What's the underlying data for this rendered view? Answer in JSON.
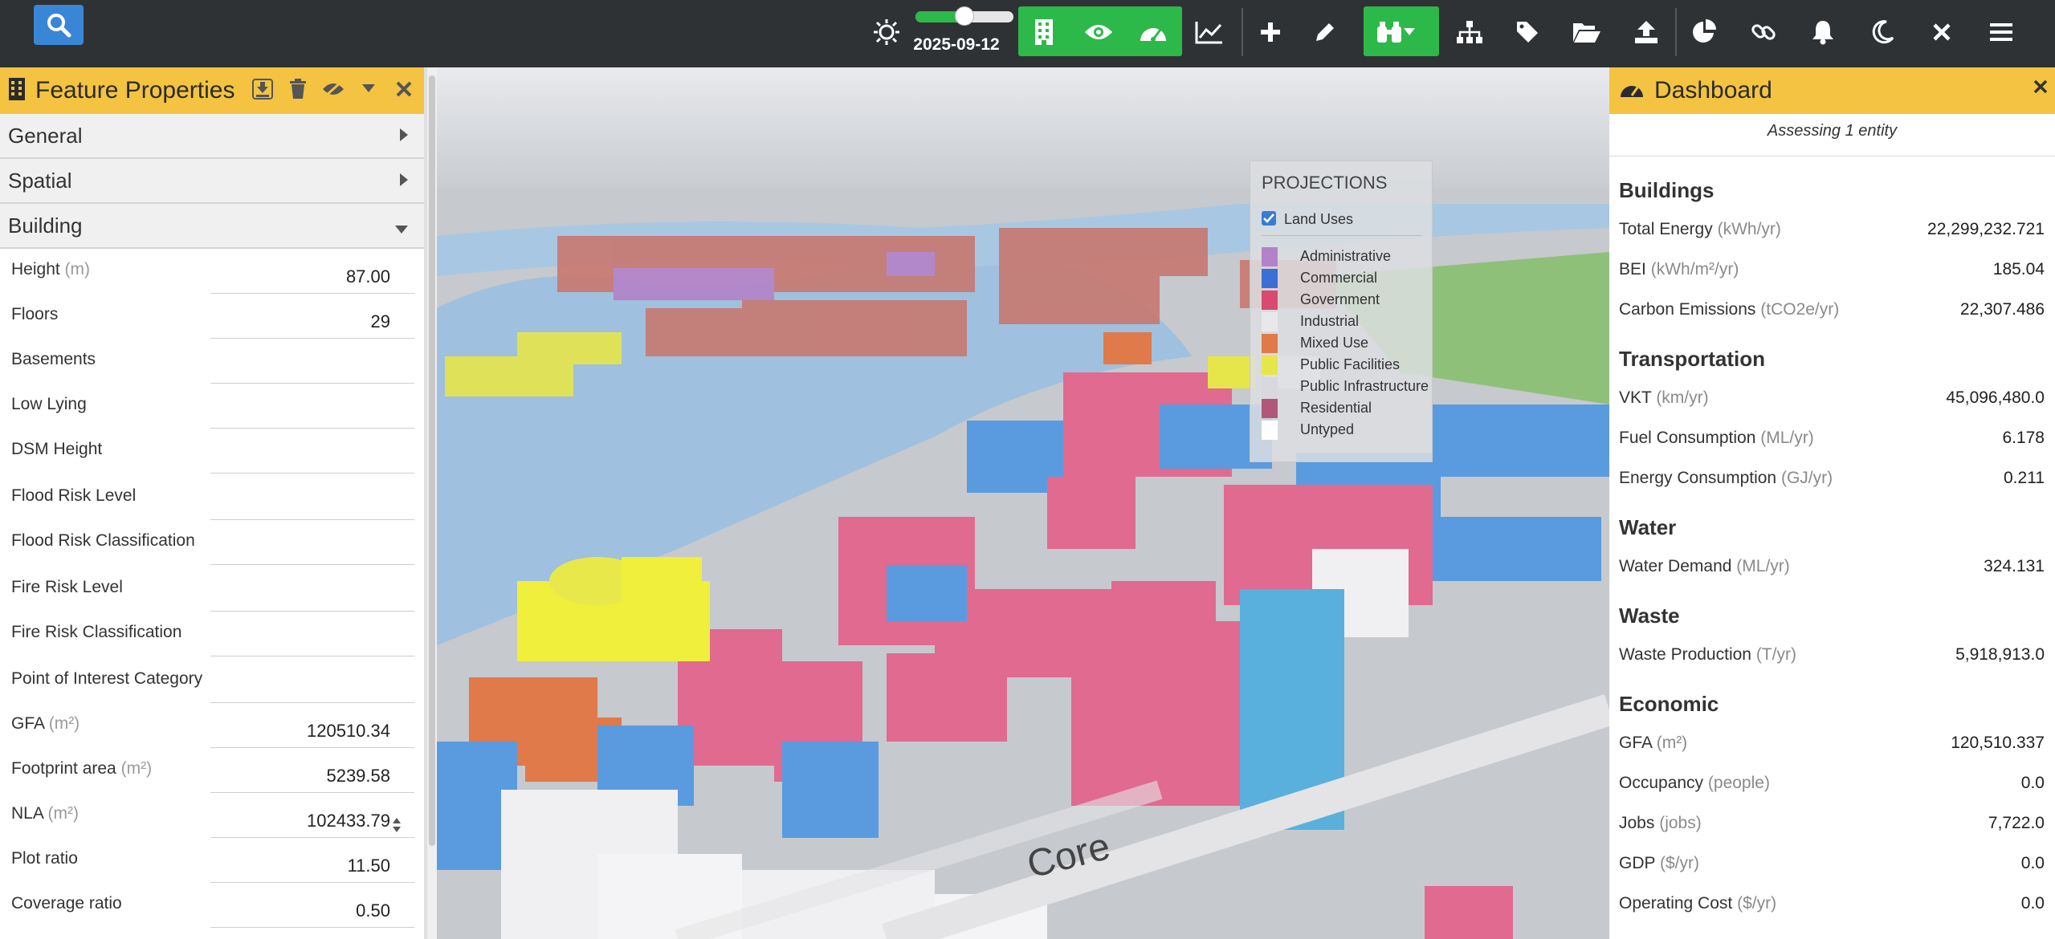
{
  "topbar": {
    "date": "2025-09-12",
    "time_slider_value_fraction": 0.5,
    "icons": [
      "search-icon",
      "sun-icon",
      "building-icon",
      "eye-icon",
      "dashboard-gauge-icon",
      "line-chart-icon",
      "plus-icon",
      "pencil-icon",
      "binoculars-icon",
      "caret-down-icon",
      "hierarchy-icon",
      "tag-icon",
      "folder-open-icon",
      "upload-icon",
      "pie-chart-icon",
      "link-icon",
      "bell-icon",
      "moon-icon",
      "close-icon",
      "menu-icon"
    ],
    "accent_green": "#2db84a",
    "search_blue": "#3a86d6"
  },
  "left": {
    "title": "Feature Properties",
    "sections": [
      "General",
      "Spatial",
      "Building"
    ],
    "props": [
      {
        "name": "Height",
        "unit": "(m)",
        "value": "87.00"
      },
      {
        "name": "Floors",
        "unit": "",
        "value": "29"
      },
      {
        "name": "Basements",
        "unit": "",
        "value": ""
      },
      {
        "name": "Low Lying",
        "unit": "",
        "value": ""
      },
      {
        "name": "DSM Height",
        "unit": "",
        "value": ""
      },
      {
        "name": "Flood Risk Level",
        "unit": "",
        "value": ""
      },
      {
        "name": "Flood Risk Classification",
        "unit": "",
        "value": ""
      },
      {
        "name": "Fire Risk Level",
        "unit": "",
        "value": ""
      },
      {
        "name": "Fire Risk Classification",
        "unit": "",
        "value": ""
      },
      {
        "name": "Point of Interest Category",
        "unit": "",
        "value": ""
      },
      {
        "name": "GFA",
        "unit": "(m²)",
        "value": "120510.34"
      },
      {
        "name": "Footprint area",
        "unit": "(m²)",
        "value": "5239.58"
      },
      {
        "name": "NLA",
        "unit": "(m²)",
        "value": "102433.79"
      },
      {
        "name": "Plot ratio",
        "unit": "",
        "value": "11.50"
      },
      {
        "name": "Coverage ratio",
        "unit": "",
        "value": "0.50"
      }
    ]
  },
  "legend": {
    "title": "PROJECTIONS",
    "layer_label": "Land Uses",
    "layer_checked": true,
    "items": [
      {
        "name": "Administrative",
        "color": "#b482c8"
      },
      {
        "name": "Commercial",
        "color": "#3a6fd6"
      },
      {
        "name": "Government",
        "color": "#d84a6e"
      },
      {
        "name": "Industrial",
        "color": "#e8e8ea"
      },
      {
        "name": "Mixed Use",
        "color": "#e07a4a"
      },
      {
        "name": "Public Facilities",
        "color": "#e6e64a"
      },
      {
        "name": "Public Infrastructure",
        "color": "#d8d8de"
      },
      {
        "name": "Residential",
        "color": "#b0587a"
      },
      {
        "name": "Untyped",
        "color": "#ffffff"
      }
    ]
  },
  "dashboard": {
    "title": "Dashboard",
    "assessing": "Assessing 1 entity",
    "sections": [
      {
        "title": "Buildings",
        "rows": [
          {
            "k": "Total Energy",
            "u": "(kWh/yr)",
            "v": "22,299,232.721"
          },
          {
            "k": "BEI",
            "u": "(kWh/m²/yr)",
            "v": "185.04"
          },
          {
            "k": "Carbon Emissions",
            "u": "(tCO2e/yr)",
            "v": "22,307.486"
          }
        ]
      },
      {
        "title": "Transportation",
        "rows": [
          {
            "k": "VKT",
            "u": "(km/yr)",
            "v": "45,096,480.0"
          },
          {
            "k": "Fuel Consumption",
            "u": "(ML/yr)",
            "v": "6.178"
          },
          {
            "k": "Energy Consumption",
            "u": "(GJ/yr)",
            "v": "0.211"
          }
        ]
      },
      {
        "title": "Water",
        "rows": [
          {
            "k": "Water Demand",
            "u": "(ML/yr)",
            "v": "324.131"
          }
        ]
      },
      {
        "title": "Waste",
        "rows": [
          {
            "k": "Waste Production",
            "u": "(T/yr)",
            "v": "5,918,913.0"
          }
        ]
      },
      {
        "title": "Economic",
        "rows": [
          {
            "k": "GFA",
            "u": "(m²)",
            "v": "120,510.337"
          },
          {
            "k": "Occupancy",
            "u": "(people)",
            "v": "0.0"
          },
          {
            "k": "Jobs",
            "u": "(jobs)",
            "v": "7,722.0"
          },
          {
            "k": "GDP",
            "u": "($/yr)",
            "v": "0.0"
          },
          {
            "k": "Operating Cost",
            "u": "($/yr)",
            "v": "0.0"
          }
        ]
      }
    ]
  },
  "map": {
    "street_label": "Core"
  }
}
